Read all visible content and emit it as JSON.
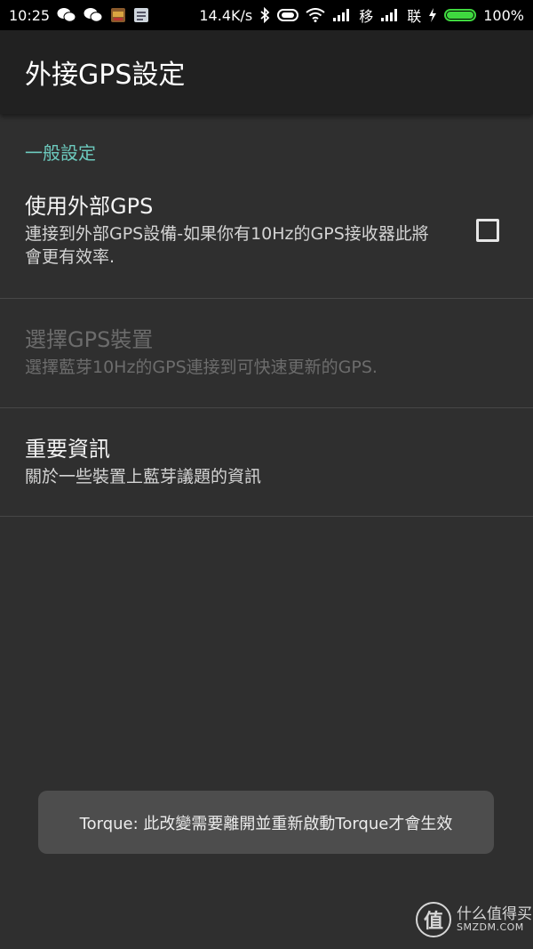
{
  "status_bar": {
    "time": "10:25",
    "net_speed": "14.4K/s",
    "carrier1": "移",
    "carrier2": "联",
    "battery_text": "100%",
    "battery_level": 1.0,
    "battery_color": "#3fd83f",
    "icons": [
      "wechat-icon",
      "wechat-icon",
      "game-app-icon",
      "notes-icon",
      "bluetooth-icon",
      "toggle-icon",
      "wifi-icon",
      "signal-icon",
      "signal-icon",
      "charging-icon",
      "battery-icon"
    ]
  },
  "action_bar": {
    "title": "外接GPS設定"
  },
  "settings": {
    "category": "一般設定",
    "items": [
      {
        "title": "使用外部GPS",
        "summary": "連接到外部GPS設備-如果你有10Hz的GPS接收器此將會更有效率.",
        "checked": false,
        "enabled": true
      },
      {
        "title": "選擇GPS裝置",
        "summary": "選擇藍芽10Hz的GPS連接到可快速更新的GPS.",
        "enabled": false
      },
      {
        "title": "重要資訊",
        "summary": "關於一些裝置上藍芽議題的資訊",
        "enabled": true
      }
    ]
  },
  "toast": {
    "message": "Torque: 此改變需要離開並重新啟動Torque才會生效"
  },
  "watermark": {
    "logo_char": "值",
    "text_cn": "什么值得买",
    "text_en": "SMZDM.COM"
  },
  "colors": {
    "accent": "#6cc9bd",
    "background": "#2f2f2f",
    "action_bar": "#212121"
  }
}
